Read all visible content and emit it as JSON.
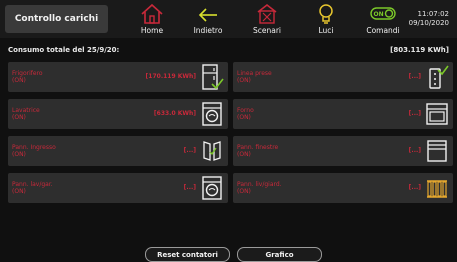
{
  "header": {
    "title": "Controllo carichi",
    "nav": [
      {
        "label": "Home",
        "icon": "home-icon"
      },
      {
        "label": "Indietro",
        "icon": "back-arrow-icon"
      },
      {
        "label": "Scenari",
        "icon": "scenes-icon"
      },
      {
        "label": "Luci",
        "icon": "light-bulb-icon"
      },
      {
        "label": "Comandi",
        "icon": "toggle-on-icon",
        "toggle_text": "ON"
      }
    ],
    "time": "11:07:02",
    "date": "09/10/2020"
  },
  "consumo": {
    "label": "Consumo totale del 25/9/20:",
    "value": "[803.119 KWh]"
  },
  "loads": [
    {
      "name": "Frigorifero",
      "state": "(ON)",
      "value": "[170.119 KWh]",
      "icon": "fridge-icon"
    },
    {
      "name": "Linea prese",
      "state": "(ON)",
      "value": "[...]",
      "icon": "socket-line-icon"
    },
    {
      "name": "Lavatrice",
      "state": "(ON)",
      "value": "[633.0 KWh]",
      "icon": "washing-machine-icon"
    },
    {
      "name": "Forno",
      "state": "(ON)",
      "value": "[...]",
      "icon": "oven-icon"
    },
    {
      "name": "Pann. Ingresso",
      "state": "(ON)",
      "value": "[...]",
      "icon": "door-panel-icon"
    },
    {
      "name": "Pann. finestre",
      "state": "(ON)",
      "value": "[...]",
      "icon": "window-shutter-icon"
    },
    {
      "name": "Pann. lav/gar.",
      "state": "(ON)",
      "value": "[...]",
      "icon": "washing-machine-icon"
    },
    {
      "name": "Pann. liv/giard.",
      "state": "(ON)",
      "value": "[...]",
      "icon": "radiator-icon"
    }
  ],
  "buttons": {
    "reset": "Reset contatori",
    "chart": "Grafico"
  },
  "colors": {
    "accent": "#c8293a",
    "green": "#7bc829",
    "yellow": "#e6c52e"
  }
}
